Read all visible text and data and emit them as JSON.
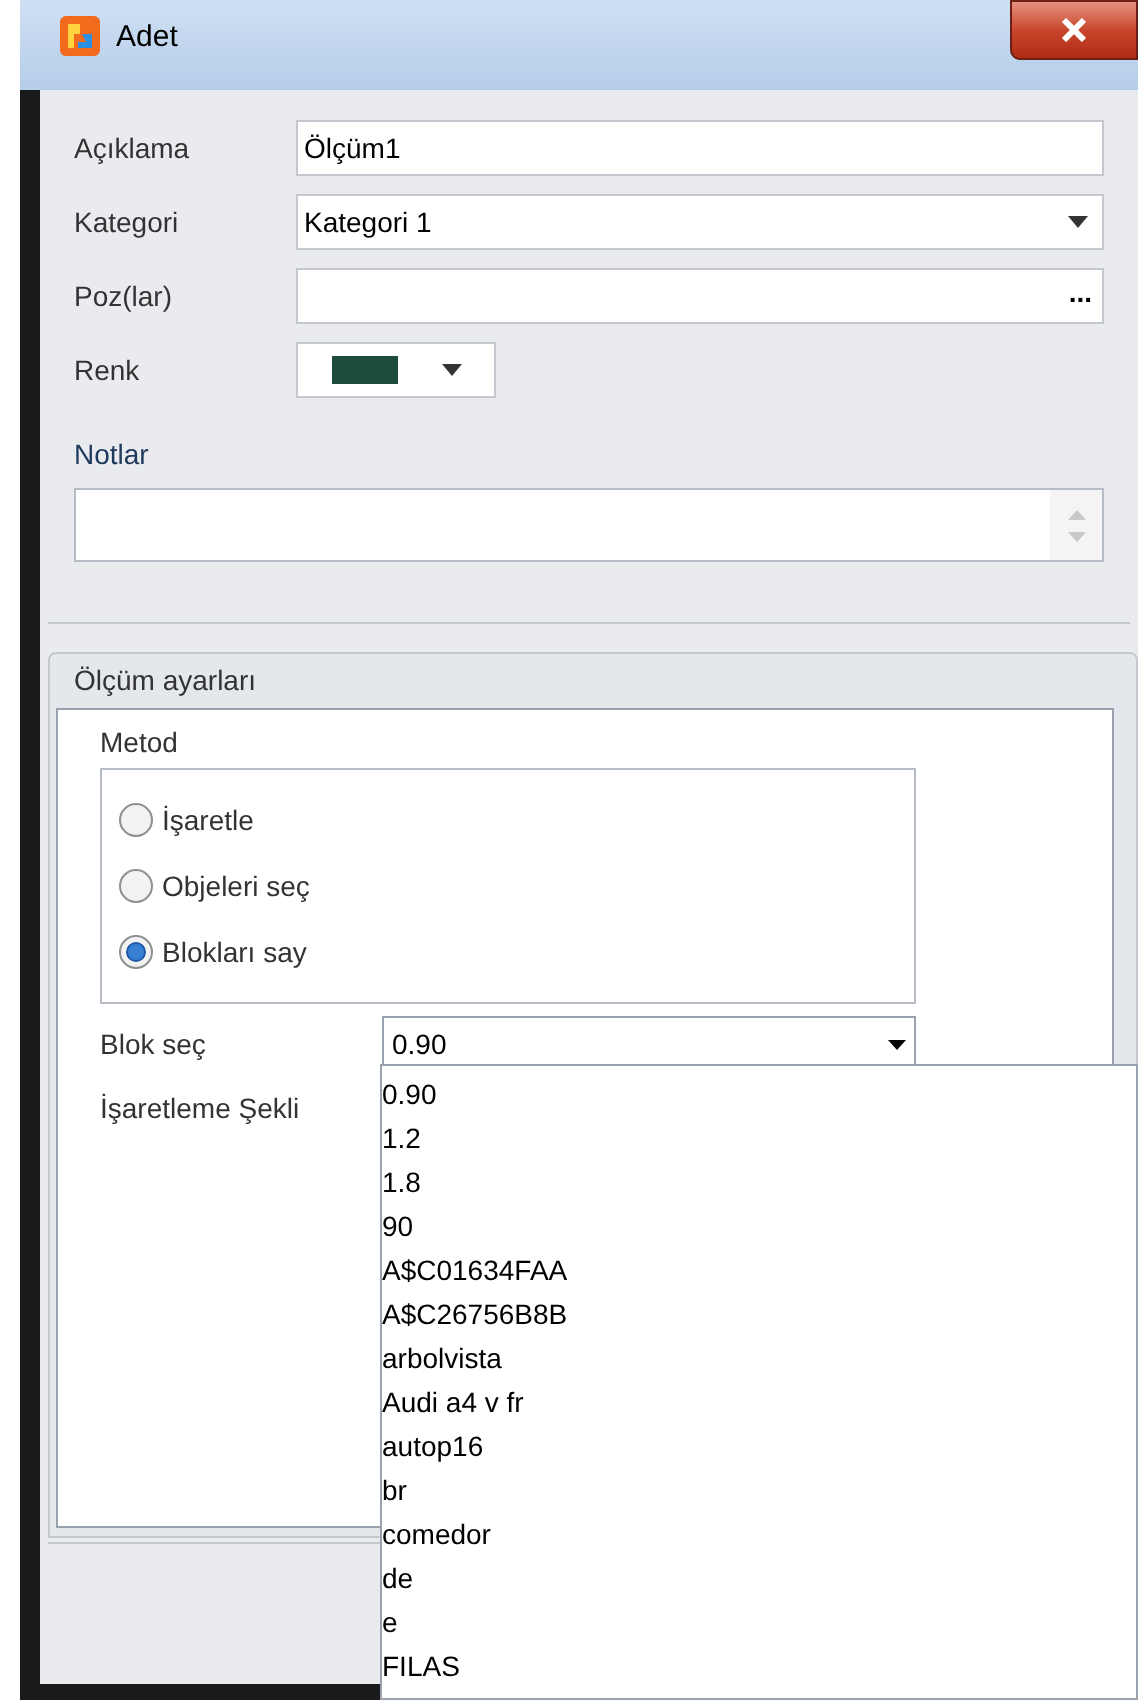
{
  "window": {
    "title": "Adet"
  },
  "fields": [
    {
      "kind": "text",
      "label": "Açıklama",
      "value": "Ölçüm1"
    },
    {
      "kind": "combo",
      "label": "Kategori",
      "value": "Kategori 1"
    },
    {
      "kind": "browse",
      "label": "Poz(lar)",
      "button": "..."
    },
    {
      "kind": "color",
      "label": "Renk",
      "color": "#1d4d3a"
    }
  ],
  "notes": {
    "label": "Notlar"
  },
  "settings": {
    "title": "Ölçüm ayarları",
    "method": {
      "label": "Metod",
      "options": [
        {
          "label": "İşaretle",
          "selected": false
        },
        {
          "label": "Objeleri seç",
          "selected": false
        },
        {
          "label": "Blokları say",
          "selected": true
        }
      ]
    },
    "block": {
      "label": "Blok seç",
      "value": "0.90"
    },
    "marking": {
      "label": "İşaretleme Şekli"
    }
  },
  "dropdown": {
    "items": [
      "0.90",
      "1.2",
      "1.8",
      "90",
      "A$C01634FAA",
      "A$C26756B8B",
      "arbolvista",
      "Audi a4 v fr",
      "autop16",
      "br",
      "comedor",
      "de",
      "e",
      "FILAS"
    ]
  }
}
